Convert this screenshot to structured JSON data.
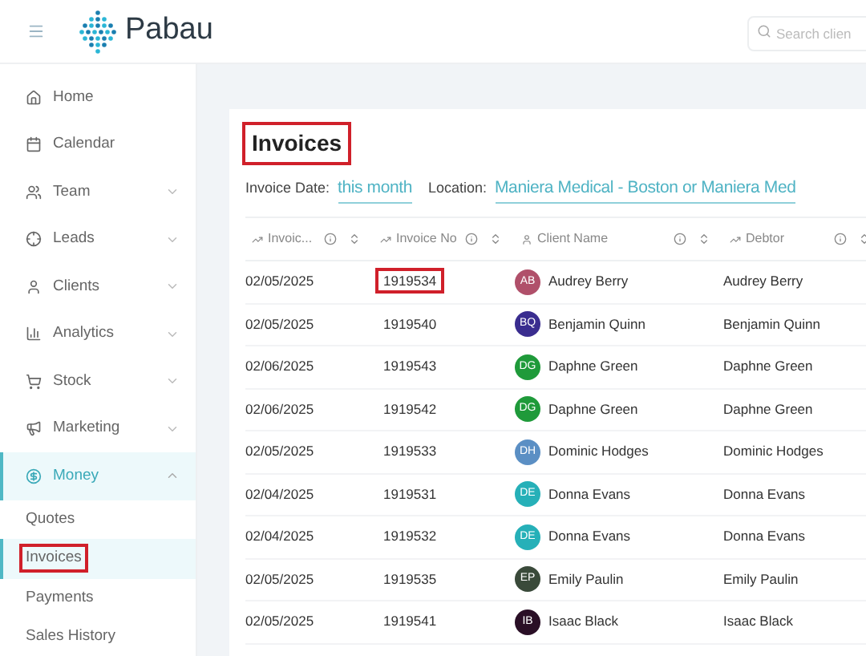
{
  "header": {
    "logo_text": "Pabau",
    "search": {
      "placeholder": "Search clien"
    }
  },
  "sidebar": {
    "items": [
      {
        "label": "Home",
        "selected": false
      },
      {
        "label": "Calendar",
        "selected": false
      },
      {
        "label": "Team",
        "expanded": false,
        "selected": false
      },
      {
        "label": "Leads",
        "expanded": false,
        "selected": false
      },
      {
        "label": "Clients",
        "expanded": false,
        "selected": false
      },
      {
        "label": "Analytics",
        "expanded": false,
        "selected": false
      },
      {
        "label": "Stock",
        "expanded": false,
        "selected": false
      },
      {
        "label": "Marketing",
        "expanded": false,
        "selected": false
      },
      {
        "label": "Money",
        "expanded": true,
        "selected": true,
        "children": [
          {
            "label": "Quotes",
            "selected": false,
            "highlighted": false
          },
          {
            "label": "Invoices",
            "selected": true,
            "highlighted": true
          },
          {
            "label": "Payments",
            "selected": false,
            "highlighted": false
          },
          {
            "label": "Sales History",
            "selected": false,
            "highlighted": false
          }
        ]
      }
    ]
  },
  "page": {
    "title": "Invoices",
    "title_highlighted": true,
    "filters": [
      {
        "label": "Invoice Date:",
        "value": "this month"
      },
      {
        "label": "Location:",
        "value": "Maniera Medical - Boston or Maniera Med"
      }
    ]
  },
  "table": {
    "columns": [
      {
        "label": "Invoic..."
      },
      {
        "label": "Invoice No"
      },
      {
        "label": "Client Name"
      },
      {
        "label": "Debtor"
      }
    ],
    "rows": [
      {
        "date": "02/05/2025",
        "invoice_no": "1919534",
        "highlighted": true,
        "initials": "AB",
        "color": "#b0506a",
        "client": "Audrey Berry",
        "debtor": "Audrey Berry"
      },
      {
        "date": "02/05/2025",
        "invoice_no": "1919540",
        "highlighted": false,
        "initials": "BQ",
        "color": "#3a2d8f",
        "client": "Benjamin Quinn",
        "debtor": "Benjamin Quinn"
      },
      {
        "date": "02/06/2025",
        "invoice_no": "1919543",
        "highlighted": false,
        "initials": "DG",
        "color": "#1f9a3a",
        "client": "Daphne Green",
        "debtor": "Daphne Green"
      },
      {
        "date": "02/06/2025",
        "invoice_no": "1919542",
        "highlighted": false,
        "initials": "DG",
        "color": "#1f9a3a",
        "client": "Daphne Green",
        "debtor": "Daphne Green"
      },
      {
        "date": "02/05/2025",
        "invoice_no": "1919533",
        "highlighted": false,
        "initials": "DH",
        "color": "#5b8fc4",
        "client": "Dominic Hodges",
        "debtor": "Dominic Hodges"
      },
      {
        "date": "02/04/2025",
        "invoice_no": "1919531",
        "highlighted": false,
        "initials": "DE",
        "color": "#26b0b8",
        "client": "Donna Evans",
        "debtor": "Donna Evans"
      },
      {
        "date": "02/04/2025",
        "invoice_no": "1919532",
        "highlighted": false,
        "initials": "DE",
        "color": "#26b0b8",
        "client": "Donna Evans",
        "debtor": "Donna Evans"
      },
      {
        "date": "02/05/2025",
        "invoice_no": "1919535",
        "highlighted": false,
        "initials": "EP",
        "color": "#3a4a3a",
        "client": "Emily Paulin",
        "debtor": "Emily Paulin"
      },
      {
        "date": "02/05/2025",
        "invoice_no": "1919541",
        "highlighted": false,
        "initials": "IB",
        "color": "#2a0f26",
        "client": "Isaac Black",
        "debtor": "Isaac Black"
      }
    ]
  }
}
